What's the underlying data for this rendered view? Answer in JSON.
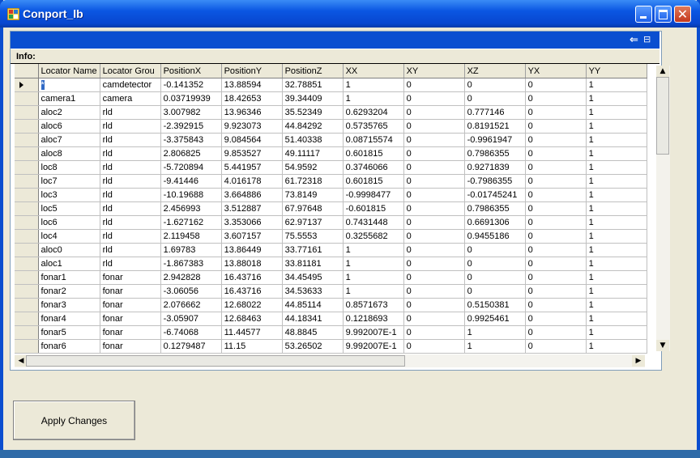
{
  "window": {
    "title": "Conport_lb"
  },
  "info_label": "Info:",
  "apply_label": "Apply Changes",
  "columns": [
    "Locator Name",
    "Locator Grou",
    "PositionX",
    "PositionY",
    "PositionZ",
    "XX",
    "XY",
    "XZ",
    "YX",
    "YY"
  ],
  "rows": [
    [
      "*",
      "camdetector",
      "-0.141352",
      "13.88594",
      "32.78851",
      "1",
      "0",
      "0",
      "0",
      "1"
    ],
    [
      "camera1",
      "camera",
      "0.03719939",
      "18.42653",
      "39.34409",
      "1",
      "0",
      "0",
      "0",
      "1"
    ],
    [
      "aloc2",
      "rld",
      "3.007982",
      "13.96346",
      "35.52349",
      "0.6293204",
      "0",
      "0.777146",
      "0",
      "1"
    ],
    [
      "aloc6",
      "rld",
      "-2.392915",
      "9.923073",
      "44.84292",
      "0.5735765",
      "0",
      "0.8191521",
      "0",
      "1"
    ],
    [
      "aloc7",
      "rld",
      "-3.375843",
      "9.084564",
      "51.40338",
      "0.08715574",
      "0",
      "-0.9961947",
      "0",
      "1"
    ],
    [
      "aloc8",
      "rld",
      "2.806825",
      "9.853527",
      "49.11117",
      "0.601815",
      "0",
      "0.7986355",
      "0",
      "1"
    ],
    [
      "loc8",
      "rld",
      "-5.720894",
      "5.441957",
      "54.9592",
      "0.3746066",
      "0",
      "0.9271839",
      "0",
      "1"
    ],
    [
      "loc7",
      "rld",
      "-9.41446",
      "4.016178",
      "61.72318",
      "0.601815",
      "0",
      "-0.7986355",
      "0",
      "1"
    ],
    [
      "loc3",
      "rld",
      "-10.19688",
      "3.664886",
      "73.8149",
      "-0.9998477",
      "0",
      "-0.01745241",
      "0",
      "1"
    ],
    [
      "loc5",
      "rld",
      "2.456993",
      "3.512887",
      "67.97648",
      "-0.601815",
      "0",
      "0.7986355",
      "0",
      "1"
    ],
    [
      "loc6",
      "rld",
      "-1.627162",
      "3.353066",
      "62.97137",
      "0.7431448",
      "0",
      "0.6691306",
      "0",
      "1"
    ],
    [
      "loc4",
      "rld",
      "2.119458",
      "3.607157",
      "75.5553",
      "0.3255682",
      "0",
      "0.9455186",
      "0",
      "1"
    ],
    [
      "aloc0",
      "rld",
      "1.69783",
      "13.86449",
      "33.77161",
      "1",
      "0",
      "0",
      "0",
      "1"
    ],
    [
      "aloc1",
      "rld",
      "-1.867383",
      "13.88018",
      "33.81181",
      "1",
      "0",
      "0",
      "0",
      "1"
    ],
    [
      "fonar1",
      "fonar",
      "2.942828",
      "16.43716",
      "34.45495",
      "1",
      "0",
      "0",
      "0",
      "1"
    ],
    [
      "fonar2",
      "fonar",
      "-3.06056",
      "16.43716",
      "34.53633",
      "1",
      "0",
      "0",
      "0",
      "1"
    ],
    [
      "fonar3",
      "fonar",
      "2.076662",
      "12.68022",
      "44.85114",
      "0.8571673",
      "0",
      "0.5150381",
      "0",
      "1"
    ],
    [
      "fonar4",
      "fonar",
      "-3.05907",
      "12.68463",
      "44.18341",
      "0.1218693",
      "0",
      "0.9925461",
      "0",
      "1"
    ],
    [
      "fonar5",
      "fonar",
      "-6.74068",
      "11.44577",
      "48.8845",
      "9.992007E-1",
      "0",
      "1",
      "0",
      "1"
    ],
    [
      "fonar6",
      "fonar",
      "0.1279487",
      "11.15",
      "53.26502",
      "9.992007E-1",
      "0",
      "1",
      "0",
      "1"
    ]
  ]
}
